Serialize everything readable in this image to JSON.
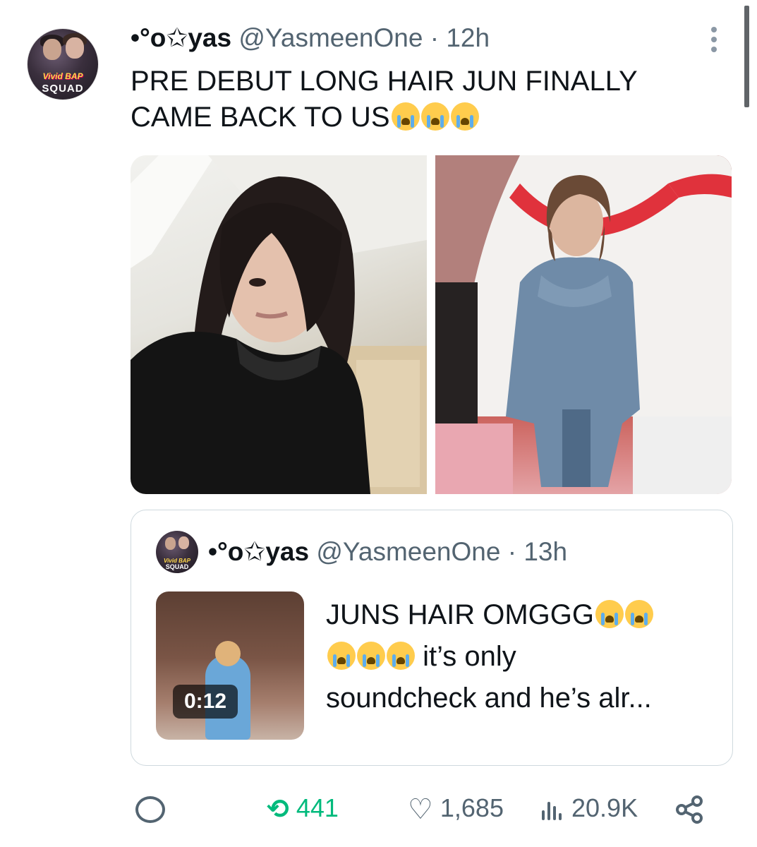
{
  "tweet": {
    "display_name": "•°o✩yas",
    "handle": "@YasmeenOne",
    "separator": "·",
    "time": "12h",
    "text": "PRE DEBUT LONG HAIR JUN FINALLY CAME BACK TO US",
    "text_emoji": "loudly-crying-face",
    "text_emoji_count": 3,
    "avatar_text_top": "Vivid BAP",
    "avatar_text_bottom": "SQUAD"
  },
  "quote": {
    "display_name": "•°o✩yas",
    "handle": "@YasmeenOne",
    "separator": "·",
    "time": "13h",
    "text_line1": "JUNS HAIR OMGGG",
    "text_line2": "it’s only",
    "text_line3": "soundcheck and he’s alr...",
    "video_duration": "0:12",
    "avatar_text_top": "Vivid BAP",
    "avatar_text_bottom": "SQUAD"
  },
  "actions": {
    "retweets": "441",
    "likes": "1,685",
    "views": "20.9K"
  },
  "colors": {
    "text": "#0f1419",
    "secondary": "#536471",
    "retweet_active": "#00ba7c",
    "border": "#cfd9de"
  }
}
